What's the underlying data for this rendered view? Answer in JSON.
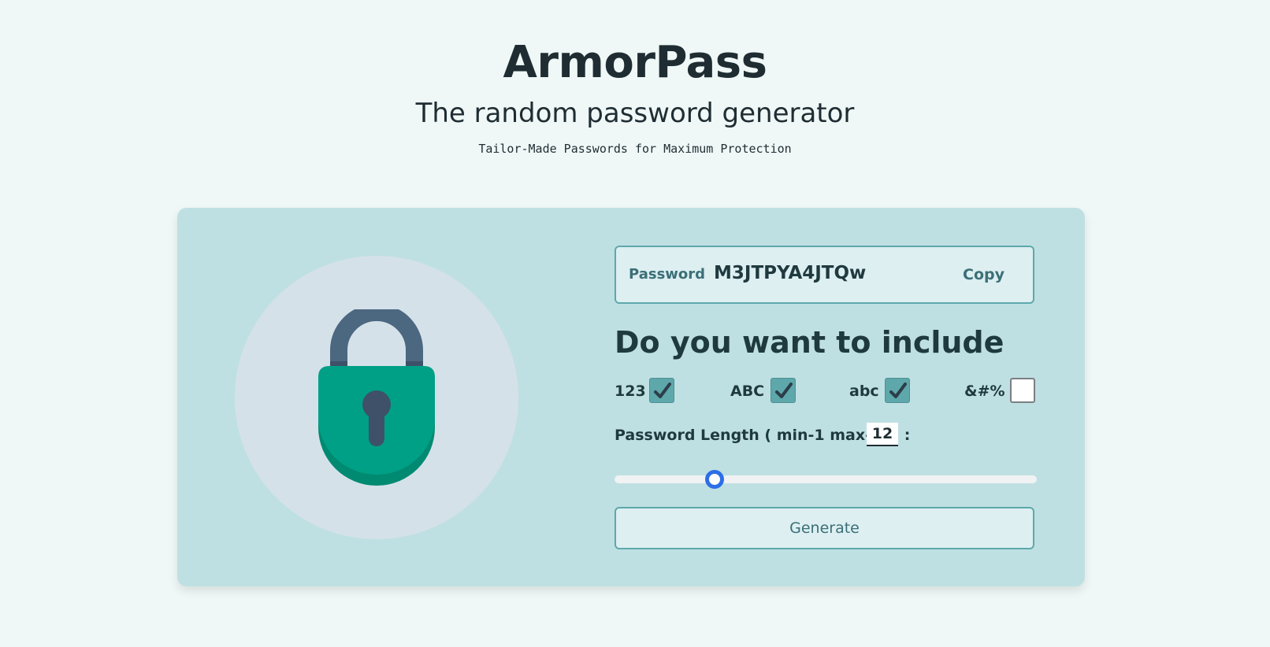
{
  "header": {
    "title": "ArmorPass",
    "subtitle": "The random password generator",
    "tagline": "Tailor-Made Passwords for Maximum Protection"
  },
  "illustration": {
    "icon": "padlock-icon"
  },
  "password": {
    "label": "Password",
    "value": "M3JTPYA4JTQw",
    "copy_label": "Copy"
  },
  "include": {
    "heading": "Do you want to include",
    "options": [
      {
        "label": "123",
        "checked": true
      },
      {
        "label": "ABC",
        "checked": true
      },
      {
        "label": "abc",
        "checked": true
      },
      {
        "label": "&#%",
        "checked": false
      }
    ]
  },
  "length": {
    "label": "Password Length ( min-1 max-50) :",
    "value": "12",
    "min": 1,
    "max": 50
  },
  "generate_label": "Generate",
  "colors": {
    "background": "#eff8f7",
    "card": "#bfe0e2",
    "accent": "#5ea8ac",
    "lock_body": "#00a086",
    "slider_thumb": "#2d6ee8"
  }
}
